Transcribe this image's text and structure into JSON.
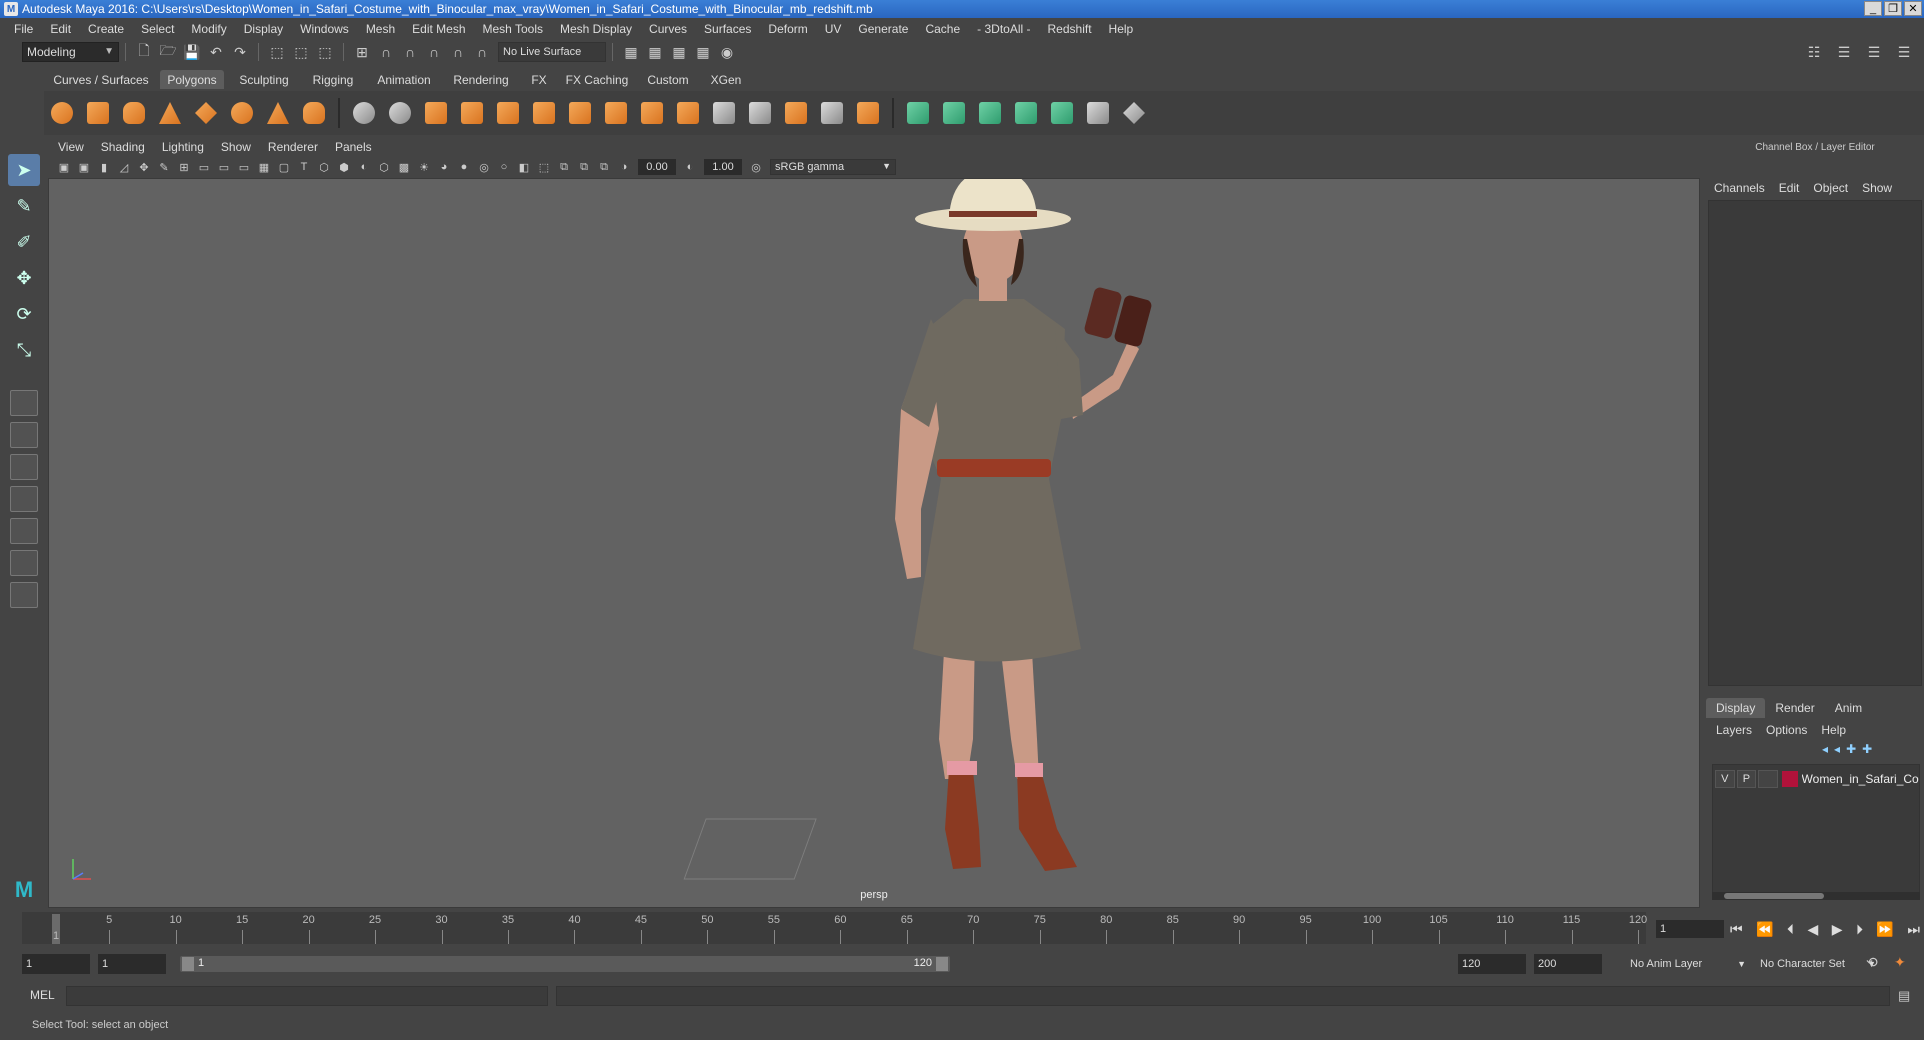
{
  "window": {
    "title": "Autodesk Maya 2016: C:\\Users\\rs\\Desktop\\Women_in_Safari_Costume_with_Binocular_max_vray\\Women_in_Safari_Costume_with_Binocular_mb_redshift.mb",
    "controls": [
      "_",
      "❐",
      "✕"
    ]
  },
  "menubar": {
    "items": [
      "File",
      "Edit",
      "Create",
      "Select",
      "Modify",
      "Display",
      "Windows",
      "Mesh",
      "Edit Mesh",
      "Mesh Tools",
      "Mesh Display",
      "Curves",
      "Surfaces",
      "Deform",
      "UV",
      "Generate",
      "Cache",
      "- 3DtoAll -",
      "Redshift",
      "Help"
    ]
  },
  "statusline": {
    "mode": "Modeling",
    "live_surface": "No Live Surface"
  },
  "shelf": {
    "tabs": [
      "Curves / Surfaces",
      "Polygons",
      "Sculpting",
      "Rigging",
      "Animation",
      "Rendering",
      "FX",
      "FX Caching",
      "Custom",
      "XGen"
    ],
    "active_tab": "Polygons"
  },
  "panel": {
    "menus": [
      "View",
      "Shading",
      "Lighting",
      "Show",
      "Renderer",
      "Panels"
    ],
    "exposure": "0.00",
    "gamma": "1.00",
    "view_transform": "sRGB gamma",
    "camera_label": "persp"
  },
  "channel_box": {
    "header": "Channel Box / Layer Editor",
    "menus": [
      "Channels",
      "Edit",
      "Object",
      "Show"
    ]
  },
  "layer_editor": {
    "tabs": [
      "Display",
      "Render",
      "Anim"
    ],
    "active_tab": "Display",
    "menus": [
      "Layers",
      "Options",
      "Help"
    ],
    "layers": [
      {
        "v": "V",
        "p": "P",
        "color": "#b0123a",
        "name": "Women_in_Safari_Costume"
      }
    ]
  },
  "timeline": {
    "ticks": [
      "5",
      "10",
      "15",
      "20",
      "25",
      "30",
      "35",
      "40",
      "45",
      "50",
      "55",
      "60",
      "65",
      "70",
      "75",
      "80",
      "85",
      "90",
      "95",
      "100",
      "105",
      "110",
      "115",
      "120"
    ],
    "current_frame_marker": "1",
    "current_frame": "1",
    "range_start": 1,
    "range_end": 120
  },
  "range": {
    "start_time": "1",
    "playback_start": "1",
    "slider_start": "1",
    "slider_end": "120",
    "playback_end": "120",
    "end_time": "200",
    "anim_layer": "No Anim Layer",
    "character_set": "No Character Set"
  },
  "command_line": {
    "label": "MEL"
  },
  "help_line": {
    "text": "Select Tool: select an object"
  },
  "colors": {
    "accent": "#5a7da8",
    "title_bar": "#2a66c0",
    "viewport_bg": "#626262"
  }
}
